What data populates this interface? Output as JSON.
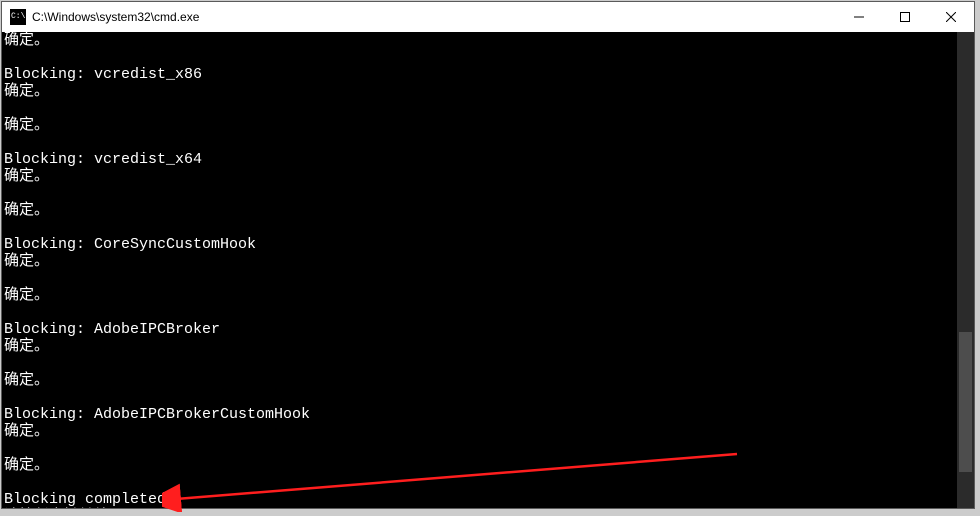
{
  "window": {
    "title": "C:\\Windows\\system32\\cmd.exe"
  },
  "console": {
    "lines": [
      "确定。",
      "",
      "Blocking: vcredist_x86",
      "确定。",
      "",
      "确定。",
      "",
      "Blocking: vcredist_x64",
      "确定。",
      "",
      "确定。",
      "",
      "Blocking: CoreSyncCustomHook",
      "确定。",
      "",
      "确定。",
      "",
      "Blocking: AdobeIPCBroker",
      "确定。",
      "",
      "确定。",
      "",
      "Blocking: AdobeIPCBrokerCustomHook",
      "确定。",
      "",
      "确定。",
      "",
      "Blocking completed.",
      "请按任意键继续. . ."
    ]
  }
}
